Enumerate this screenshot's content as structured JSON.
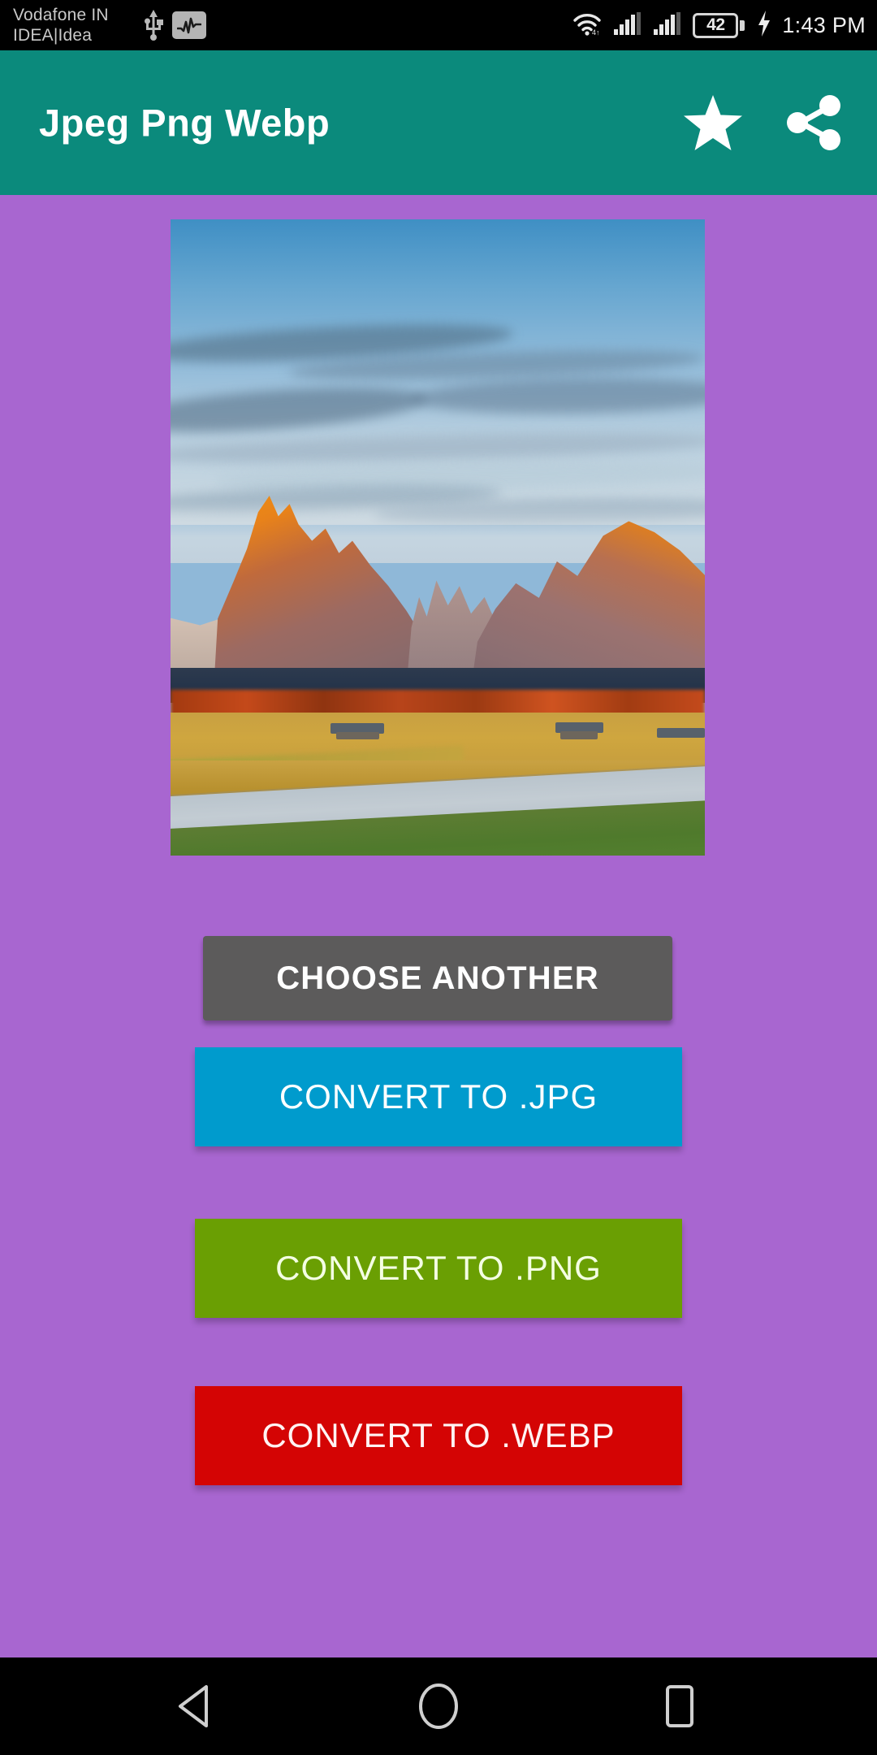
{
  "status_bar": {
    "carrier": "Vodafone IN\nIDEA|Idea",
    "usb_icon": "usb-icon",
    "activity_icon": "activity-graph-icon",
    "wifi_icon": "wifi-icon",
    "signal_icon_1": "signal-bars-icon",
    "signal_icon_2": "signal-bars-icon",
    "battery_level": "42",
    "battery_icon": "battery-icon",
    "charging_icon": "charging-bolt-icon",
    "time": "1:43 PM"
  },
  "app_bar": {
    "title": "Jpeg Png Webp",
    "background_color": "#0b8a7c",
    "star_icon": "star-icon",
    "share_icon": "share-icon"
  },
  "content": {
    "background_color": "#a866d0",
    "preview": {
      "name": "selected-image-preview",
      "description": "Mountain landscape photo at sunrise with alpenglow peaks, golden meadow and a road"
    }
  },
  "buttons": [
    {
      "label": "CHOOSE ANOTHER",
      "color": "#5c5b5b",
      "name": "choose-another-button"
    },
    {
      "label": "CONVERT TO .JPG",
      "color": "#009bcd",
      "name": "convert-to-jpg-button"
    },
    {
      "label": "CONVERT TO .PNG",
      "color": "#6a9f03",
      "name": "convert-to-png-button"
    },
    {
      "label": "CONVERT TO .WEBP",
      "color": "#d40404",
      "name": "convert-to-webp-button"
    }
  ],
  "nav_bar": {
    "back_icon": "back-triangle-icon",
    "home_icon": "home-circle-icon",
    "recents_icon": "recents-square-icon"
  }
}
